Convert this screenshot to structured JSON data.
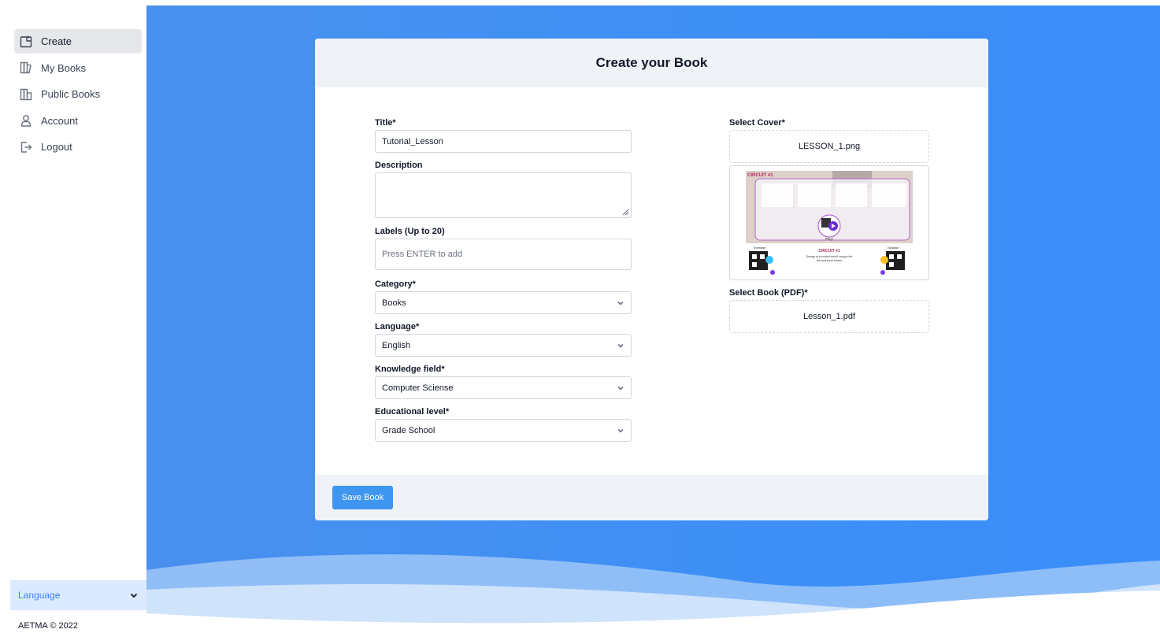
{
  "sidebar": {
    "items": [
      {
        "label": "Create",
        "icon": "create-book-icon",
        "active": true
      },
      {
        "label": "My Books",
        "icon": "my-books-icon",
        "active": false
      },
      {
        "label": "Public Books",
        "icon": "public-books-icon",
        "active": false
      },
      {
        "label": "Account",
        "icon": "account-icon",
        "active": false
      },
      {
        "label": "Logout",
        "icon": "logout-icon",
        "active": false
      }
    ],
    "language_label": "Language",
    "footer": "AETMA © 2022"
  },
  "card": {
    "title": "Create your Book",
    "save_label": "Save Book"
  },
  "form": {
    "title_label": "Title*",
    "title_value": "Tutorial_Lesson",
    "description_label": "Description",
    "description_value": "",
    "labels_label": "Labels (Up to 20)",
    "labels_placeholder": "Press ENTER to add",
    "category_label": "Category*",
    "category_value": "Books",
    "language_label": "Language*",
    "language_value": "English",
    "knowledge_label": "Knowledge field*",
    "knowledge_value": "Computer Sciense",
    "level_label": "Educational level*",
    "level_value": "Grade School",
    "cover_label": "Select Cover*",
    "cover_file": "LESSON_1.png",
    "pdf_label": "Select Book (PDF)*",
    "pdf_file": "Lesson_1.pdf"
  },
  "cover_preview": {
    "banner": "CIRCUIT #1",
    "play": "Play!",
    "exercise": "Exercise",
    "solution": "Solution",
    "heading": "CIRCUIT #1",
    "caption_line1": "Design of a control circuit using a led",
    "caption_line2": "bar and push button"
  },
  "colors": {
    "accent": "#3f96f0",
    "main_bg": "#3d8ff5",
    "card_header": "#eff3f8",
    "active_nav": "#e5e7eb"
  }
}
